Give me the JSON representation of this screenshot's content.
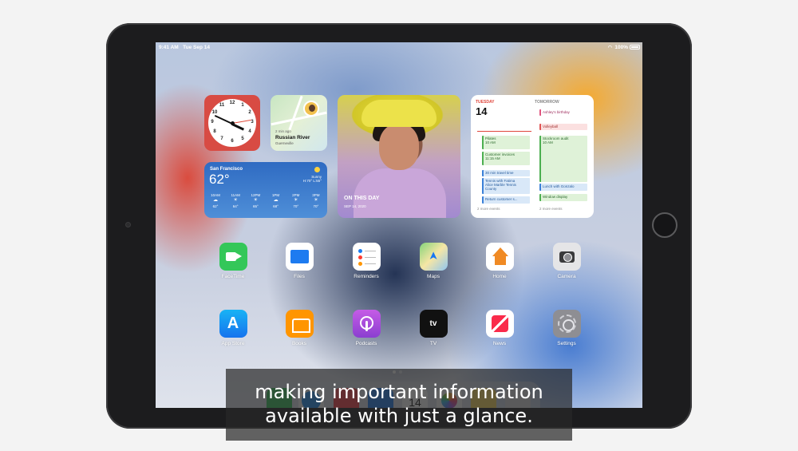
{
  "status": {
    "time": "9:41 AM",
    "date": "Tue Sep 14",
    "battery": "100%"
  },
  "widgets": {
    "clock": {
      "numerals": [
        "12",
        "1",
        "2",
        "3",
        "4",
        "5",
        "6",
        "7",
        "8",
        "9",
        "10",
        "11"
      ]
    },
    "maps": {
      "ago": "2 min ago",
      "place": "Russian River",
      "sub": "Guerneville"
    },
    "weather": {
      "city": "San Francisco",
      "temp": "62°",
      "condition": "Sunny",
      "hilo": "H:70° L:55°",
      "hours": [
        {
          "time": "10AM",
          "temp": "62°"
        },
        {
          "time": "11AM",
          "temp": "64°"
        },
        {
          "time": "12PM",
          "temp": "65°"
        },
        {
          "time": "1PM",
          "temp": "68°"
        },
        {
          "time": "2PM",
          "temp": "70°"
        },
        {
          "time": "3PM",
          "temp": "70°"
        }
      ]
    },
    "photo": {
      "label": "ON THIS DAY",
      "date": "SEP 14, 2020"
    },
    "calendar": {
      "today": {
        "day": "TUESDAY",
        "date": "14"
      },
      "tomorrow": {
        "day": "TOMORROW"
      },
      "today_events": [
        {
          "title": "Pilates",
          "time": "10 AM"
        },
        {
          "title": "Customer invoices",
          "time": "11:15 AM"
        },
        {
          "title": "30 min travel time"
        },
        {
          "title": "Tennis with Fatima",
          "time": "Alice Marble Tennis County"
        },
        {
          "title": "Return customer s..."
        }
      ],
      "tomorrow_events": [
        {
          "title": "Ashley's birthday"
        },
        {
          "title": "Volleyball"
        },
        {
          "title": "Stockroom audit",
          "time": "10 AM"
        },
        {
          "title": "Lunch with Gonzalo"
        },
        {
          "title": "Window display"
        }
      ],
      "more": "2 more events",
      "hours": [
        "9",
        "10",
        "11",
        "12",
        "1",
        "2",
        "3"
      ]
    }
  },
  "apps_row1": [
    "FaceTime",
    "Files",
    "Reminders",
    "Maps",
    "Home",
    "Camera"
  ],
  "apps_row2": [
    "App Store",
    "Books",
    "Podcasts",
    "TV",
    "News",
    "Settings"
  ],
  "tv_logo": "tv",
  "dock": {
    "calendar_date": "14"
  },
  "captions": {
    "line1": "making important information",
    "line2": "available with just a glance."
  }
}
